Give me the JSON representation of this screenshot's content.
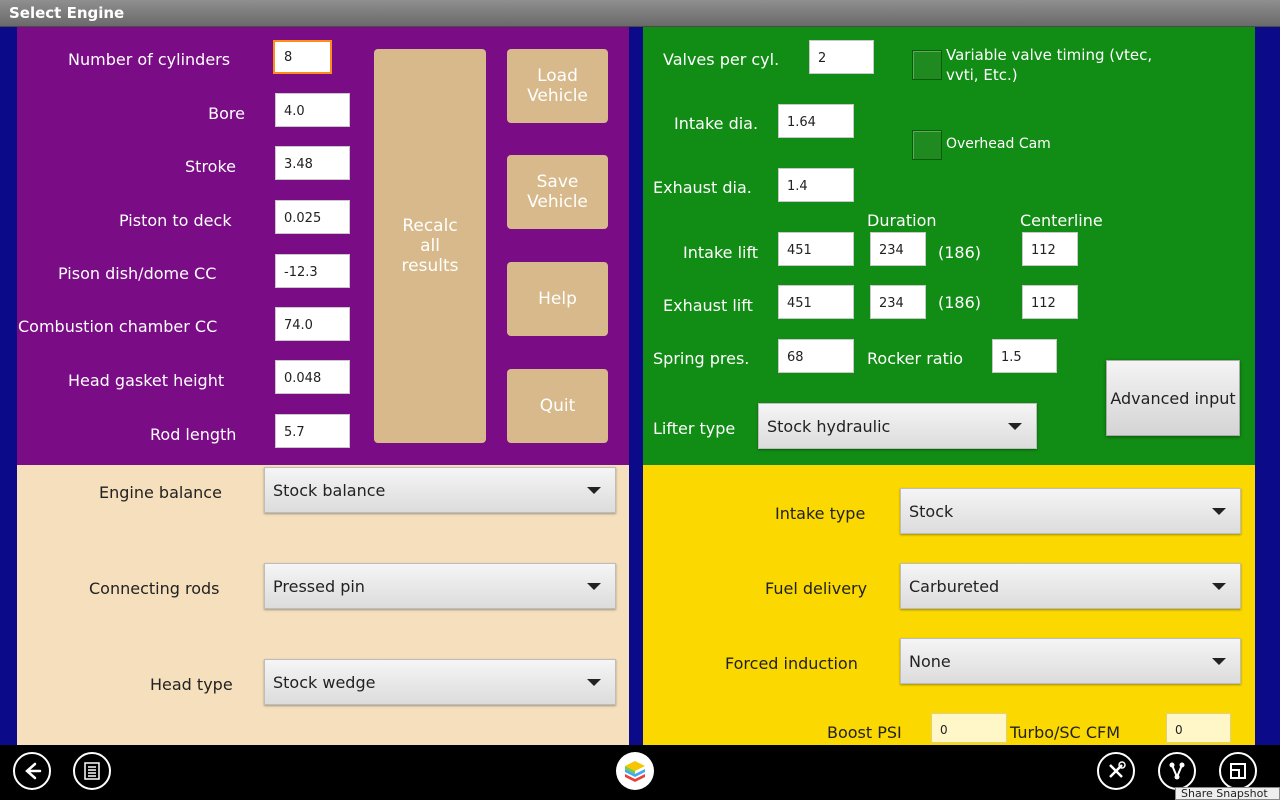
{
  "window": {
    "title": "Select Engine"
  },
  "engine": {
    "cylinders_label": "Number of cylinders",
    "cylinders": "8",
    "bore_label": "Bore",
    "bore": "4.0",
    "stroke_label": "Stroke",
    "stroke": "3.48",
    "piston_deck_label": "Piston to deck",
    "piston_deck": "0.025",
    "piston_dish_label": "Pison dish/dome CC",
    "piston_dish": "-12.3",
    "chamber_label": "Combustion chamber CC",
    "chamber": "74.0",
    "gasket_label": "Head gasket height",
    "gasket": "0.048",
    "rod_label": "Rod length",
    "rod": "5.7"
  },
  "buttons": {
    "recalc": "Recalc all results",
    "load": "Load Vehicle",
    "save": "Save Vehicle",
    "help": "Help",
    "quit": "Quit"
  },
  "valvetrain": {
    "valves_label": "Valves per cyl.",
    "valves": "2",
    "vvt_label": "Variable valve timing  (vtec, vvti, Etc.)",
    "ohc_label": "Overhead Cam",
    "intake_dia_label": "Intake dia.",
    "intake_dia": "1.64",
    "exhaust_dia_label": "Exhaust dia.",
    "exhaust_dia": "1.4",
    "duration_header": "Duration",
    "centerline_header": "Centerline",
    "intake_lift_label": "Intake lift",
    "intake_lift": "451",
    "intake_duration": "234",
    "intake_duration_calc": "(186)",
    "intake_centerline": "112",
    "exhaust_lift_label": "Exhaust lift",
    "exhaust_lift": "451",
    "exhaust_duration": "234",
    "exhaust_duration_calc": "(186)",
    "exhaust_centerline": "112",
    "spring_label": "Spring pres.",
    "spring": "68",
    "rocker_label": "Rocker ratio",
    "rocker": "1.5",
    "lifter_label": "Lifter type",
    "lifter": "Stock hydraulic",
    "advanced": "Advanced input"
  },
  "bottom_left": {
    "balance_label": "Engine balance",
    "balance": "Stock balance",
    "rods_label": "Connecting rods",
    "rods": "Pressed pin",
    "head_label": "Head type",
    "head": "Stock wedge"
  },
  "bottom_right": {
    "intake_type_label": "Intake type",
    "intake_type": "Stock",
    "fuel_label": "Fuel delivery",
    "fuel": "Carbureted",
    "forced_label": "Forced induction",
    "forced": "None",
    "boost_label": "Boost PSI",
    "boost": "0",
    "cfm_label": "Turbo/SC CFM",
    "cfm": "0"
  },
  "navbar": {
    "tooltip": "Share Snapshot"
  },
  "icons": [
    "back-icon",
    "menu-icon",
    "app-logo-icon",
    "tools-icon",
    "share-icon",
    "window-icon"
  ],
  "colors": {
    "purple": "#7a0c86",
    "green": "#118c14",
    "beige": "#f5dfbc",
    "yellow": "#fad800",
    "button": "#d7b98b",
    "frame": "#0b0b8a"
  }
}
